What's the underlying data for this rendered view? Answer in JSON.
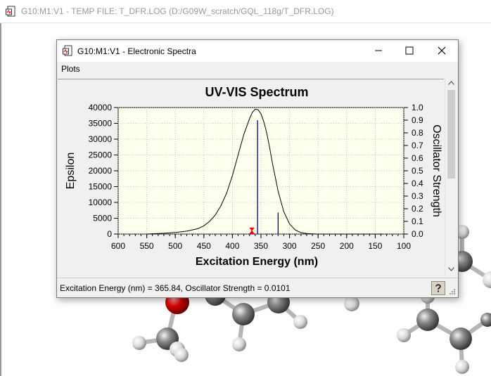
{
  "background_window": {
    "title": "G10:M1:V1 - TEMP FILE:  T_DFR.LOG (D:/G09W_scratch/GQL_118g/T_DFR.LOG)",
    "icon": "document-icon"
  },
  "dialog": {
    "title": "G10:M1:V1 - Electronic Spectra",
    "icon": "document-icon",
    "buttons": {
      "minimize": "minimize-icon",
      "maximize": "maximize-icon",
      "close": "close-icon"
    },
    "menu": [
      {
        "label": "Plots"
      }
    ],
    "status": "Excitation Energy (nm) = 365.84, Oscillator Strength = 0.0101",
    "help_icon": "help-question-icon",
    "colors": {
      "plot_bg": "#fffff0",
      "curve": "#000000",
      "sticks": "#000080",
      "marker": "#ff0000"
    }
  },
  "chart_data": {
    "type": "line",
    "title": "UV-VIS Spectrum",
    "xlabel": "Excitation Energy (nm)",
    "ylabel": "Epsilon",
    "y2label": "Oscillator Strength",
    "xlim": [
      600,
      100
    ],
    "x_reversed": true,
    "xticks": [
      600,
      550,
      500,
      450,
      400,
      350,
      300,
      250,
      200,
      150,
      100
    ],
    "ylim": [
      0,
      40000
    ],
    "yticks": [
      0,
      5000,
      10000,
      15000,
      20000,
      25000,
      30000,
      35000,
      40000
    ],
    "y2lim": [
      0,
      1.0
    ],
    "y2ticks": [
      "0.0",
      "0.1",
      "0.2",
      "0.3",
      "0.4",
      "0.5",
      "0.6",
      "0.7",
      "0.8",
      "0.9",
      "1.0"
    ],
    "grid": true,
    "series": [
      {
        "kind": "curve",
        "axis": "left",
        "x": [
          550,
          520,
          500,
          480,
          460,
          450,
          440,
          430,
          420,
          410,
          400,
          390,
          380,
          370,
          365,
          360,
          355,
          350,
          345,
          340,
          335,
          330,
          320,
          310,
          300,
          290,
          280,
          270,
          260,
          250,
          230,
          200,
          170,
          150,
          135
        ],
        "y": [
          0,
          250,
          500,
          900,
          1700,
          2600,
          4000,
          6000,
          9000,
          13000,
          18500,
          25000,
          31500,
          36500,
          38500,
          39500,
          39300,
          38000,
          35500,
          32000,
          27500,
          22500,
          13500,
          7000,
          3200,
          1300,
          450,
          150,
          50,
          10,
          0,
          0,
          0,
          0,
          0
        ]
      },
      {
        "kind": "sticks",
        "axis": "right",
        "x": [
          365.84,
          356,
          320
        ],
        "y": [
          0.0101,
          0.9,
          0.17
        ]
      }
    ],
    "marker": {
      "x": 365.84,
      "y": 0.0101
    }
  }
}
